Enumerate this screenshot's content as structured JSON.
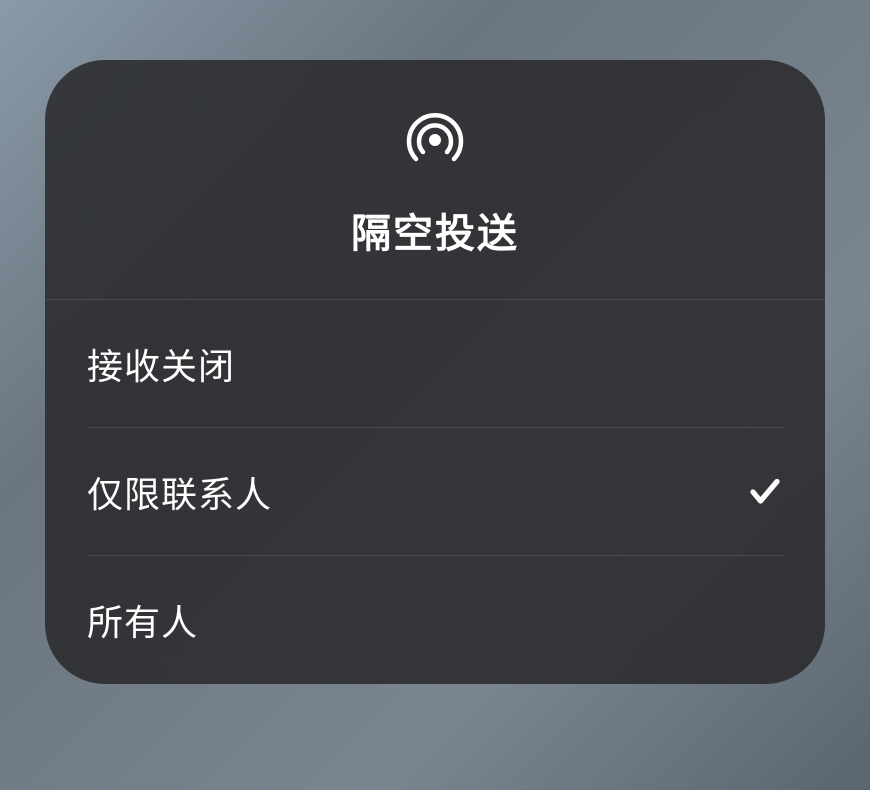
{
  "header": {
    "title": "隔空投送"
  },
  "options": [
    {
      "label": "接收关闭",
      "selected": false
    },
    {
      "label": "仅限联系人",
      "selected": true
    },
    {
      "label": "所有人",
      "selected": false
    }
  ]
}
